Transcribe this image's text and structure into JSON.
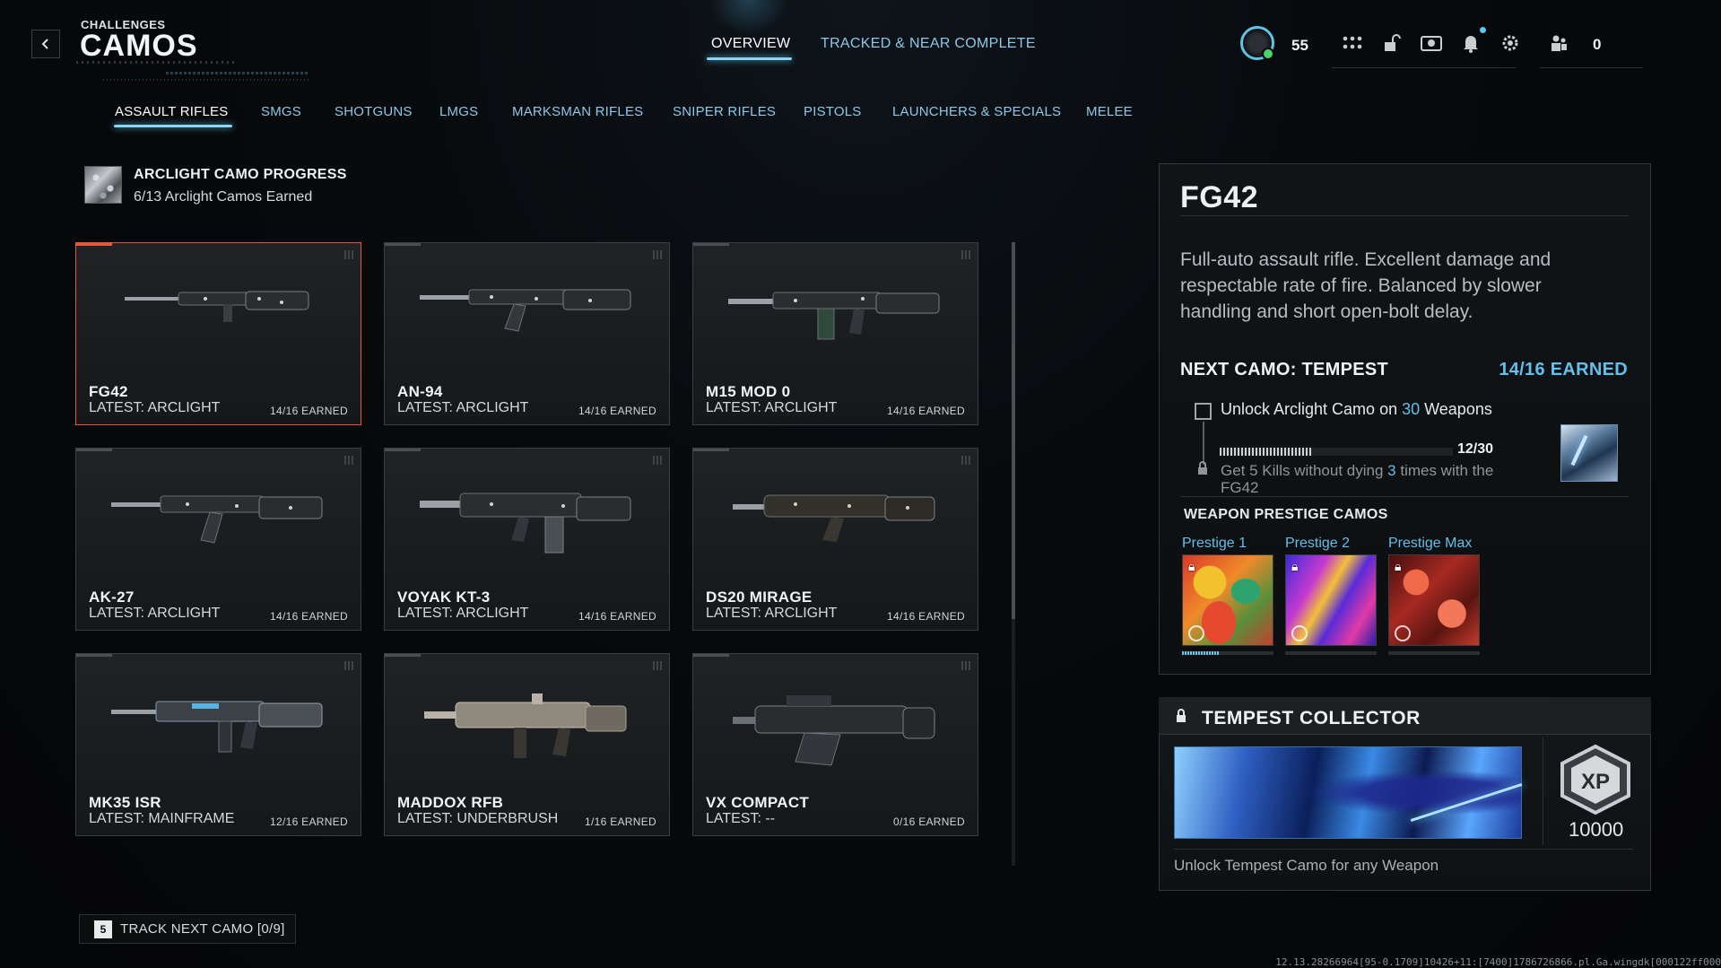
{
  "header": {
    "supertitle": "CHALLENGES",
    "title": "CAMOS",
    "back_icon": "chevron-left-icon",
    "tabs": [
      {
        "label": "OVERVIEW",
        "active": true
      },
      {
        "label": "TRACKED & NEAR COMPLETE",
        "active": false
      }
    ],
    "player_level": "55",
    "friends_online": "0",
    "icons": [
      "player-emblem-icon",
      "apps-grid-icon",
      "unlock-icon",
      "camera-icon",
      "bell-icon",
      "gear-icon",
      "friends-icon"
    ]
  },
  "categories": [
    {
      "label": "ASSAULT RIFLES",
      "active": true
    },
    {
      "label": "SMGS",
      "active": false
    },
    {
      "label": "SHOTGUNS",
      "active": false
    },
    {
      "label": "LMGS",
      "active": false
    },
    {
      "label": "MARKSMAN RIFLES",
      "active": false
    },
    {
      "label": "SNIPER RIFLES",
      "active": false
    },
    {
      "label": "PISTOLS",
      "active": false
    },
    {
      "label": "LAUNCHERS & SPECIALS",
      "active": false
    },
    {
      "label": "MELEE",
      "active": false
    }
  ],
  "arclight": {
    "title": "ARCLIGHT CAMO PROGRESS",
    "subtitle": "6/13 Arclight Camos Earned"
  },
  "weapons": [
    {
      "name": "FG42",
      "latest": "LATEST: ARCLIGHT",
      "earned": "14/16 EARNED",
      "selected": true
    },
    {
      "name": "AN-94",
      "latest": "LATEST: ARCLIGHT",
      "earned": "14/16 EARNED",
      "selected": false
    },
    {
      "name": "M15 MOD 0",
      "latest": "LATEST: ARCLIGHT",
      "earned": "14/16 EARNED",
      "selected": false
    },
    {
      "name": "AK-27",
      "latest": "LATEST: ARCLIGHT",
      "earned": "14/16 EARNED",
      "selected": false
    },
    {
      "name": "VOYAK KT-3",
      "latest": "LATEST: ARCLIGHT",
      "earned": "14/16 EARNED",
      "selected": false
    },
    {
      "name": "DS20 MIRAGE",
      "latest": "LATEST: ARCLIGHT",
      "earned": "14/16 EARNED",
      "selected": false
    },
    {
      "name": "MK35 ISR",
      "latest": "LATEST: MAINFRAME",
      "earned": "12/16 EARNED",
      "selected": false
    },
    {
      "name": "MADDOX RFB",
      "latest": "LATEST: UNDERBRUSH",
      "earned": "1/16 EARNED",
      "selected": false
    },
    {
      "name": "VX COMPACT",
      "latest": "LATEST: --",
      "earned": "0/16 EARNED",
      "selected": false
    }
  ],
  "track": {
    "key": "5",
    "label": "TRACK NEXT CAMO [0/9]"
  },
  "detail": {
    "title": "FG42",
    "description": "Full-auto assault rifle. Excellent damage and respectable rate of fire. Balanced by slower handling and short open-bolt delay.",
    "next_camo": "NEXT CAMO: TEMPEST",
    "earned": "14/16 EARNED",
    "challenge": {
      "pre": "Unlock Arclight Camo on ",
      "count": "30",
      "post": " Weapons",
      "progress_text": "12/30",
      "progress": 0.4,
      "sub_pre": "Get 5 Kills without dying ",
      "sub_count": "3",
      "sub_post": " times with the FG42"
    },
    "prestige_title": "WEAPON PRESTIGE CAMOS",
    "prestige": [
      {
        "label": "Prestige 1",
        "progress": 0.4
      },
      {
        "label": "Prestige 2",
        "progress": 0
      },
      {
        "label": "Prestige Max",
        "progress": 0
      }
    ]
  },
  "collector": {
    "title": "TEMPEST COLLECTOR",
    "xp_label": "XP",
    "xp_value": "10000",
    "description": "Unlock Tempest Camo for any Weapon"
  },
  "build_string": "12.13.28266964[95-0.1709]10426+11:[7400]1786726866.pl.Ga.wingdk[000122ff000",
  "colors": {
    "accent": "#64bfea",
    "selected_border": "#e5583a"
  }
}
